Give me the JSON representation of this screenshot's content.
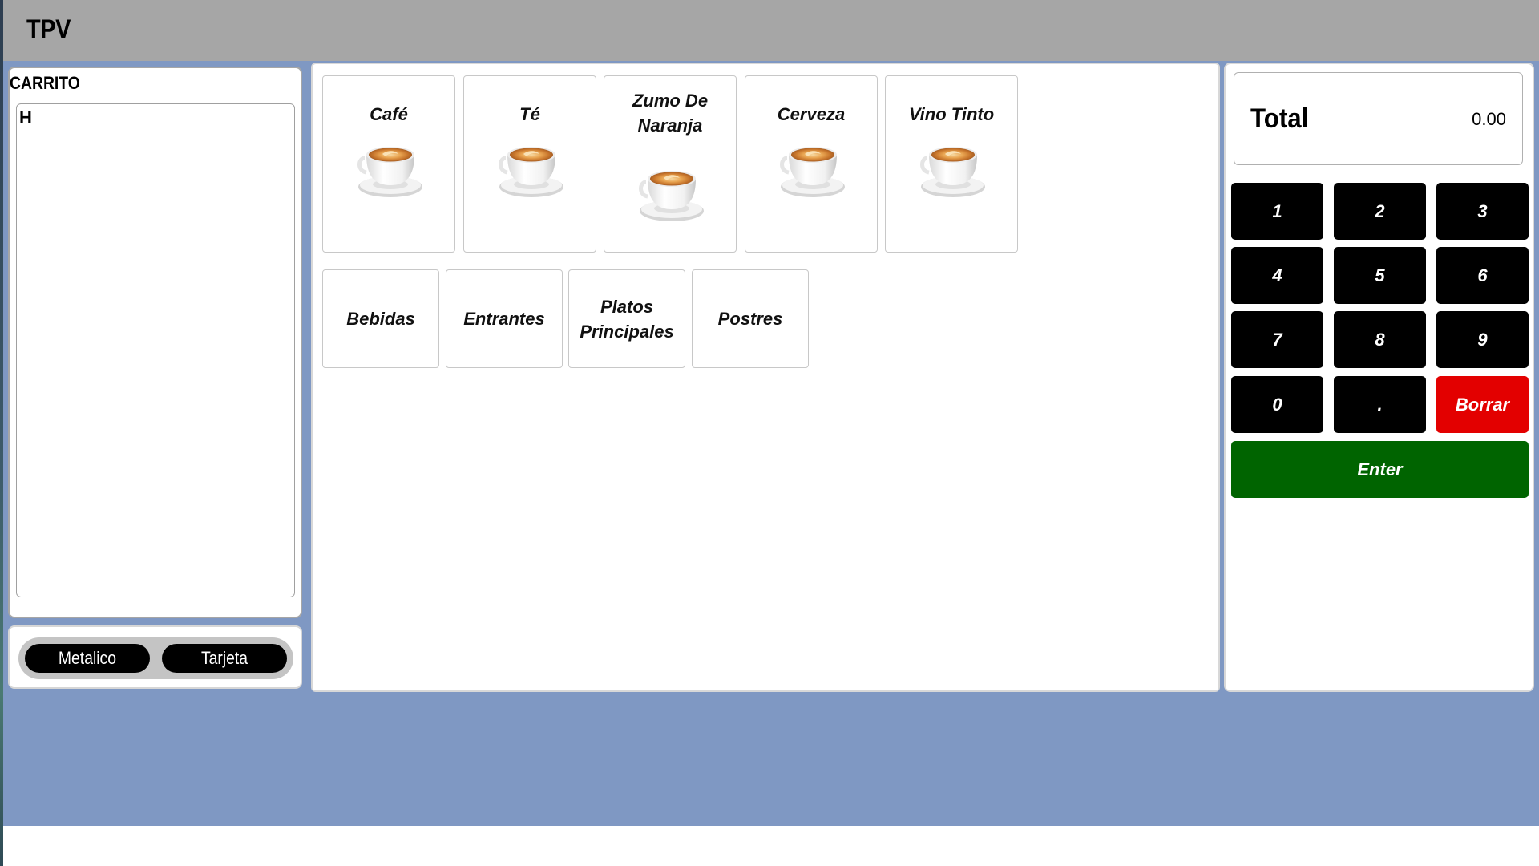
{
  "app": {
    "title": "TPV"
  },
  "cart": {
    "title": "CARRITO",
    "items": [
      "H"
    ]
  },
  "payment": {
    "cash_label": "Metalico",
    "card_label": "Tarjeta"
  },
  "products": [
    {
      "name": "Café",
      "icon": "coffee-cup-icon"
    },
    {
      "name": "Té",
      "icon": "coffee-cup-icon"
    },
    {
      "name": "Zumo De Naranja",
      "icon": "coffee-cup-icon"
    },
    {
      "name": "Cerveza",
      "icon": "coffee-cup-icon"
    },
    {
      "name": "Vino Tinto",
      "icon": "coffee-cup-icon"
    }
  ],
  "categories": [
    "Bebidas",
    "Entrantes",
    "Platos Principales",
    "Postres"
  ],
  "total": {
    "label": "Total",
    "value": "0.00"
  },
  "numpad": {
    "keys": [
      "1",
      "2",
      "3",
      "4",
      "5",
      "6",
      "7",
      "8",
      "9",
      "0",
      ".",
      "Borrar"
    ],
    "enter_label": "Enter"
  },
  "colors": {
    "header": "#a6a6a6",
    "background": "#7f98c3",
    "key": "#000000",
    "delete_key": "#e30000",
    "enter_key": "#006400"
  }
}
